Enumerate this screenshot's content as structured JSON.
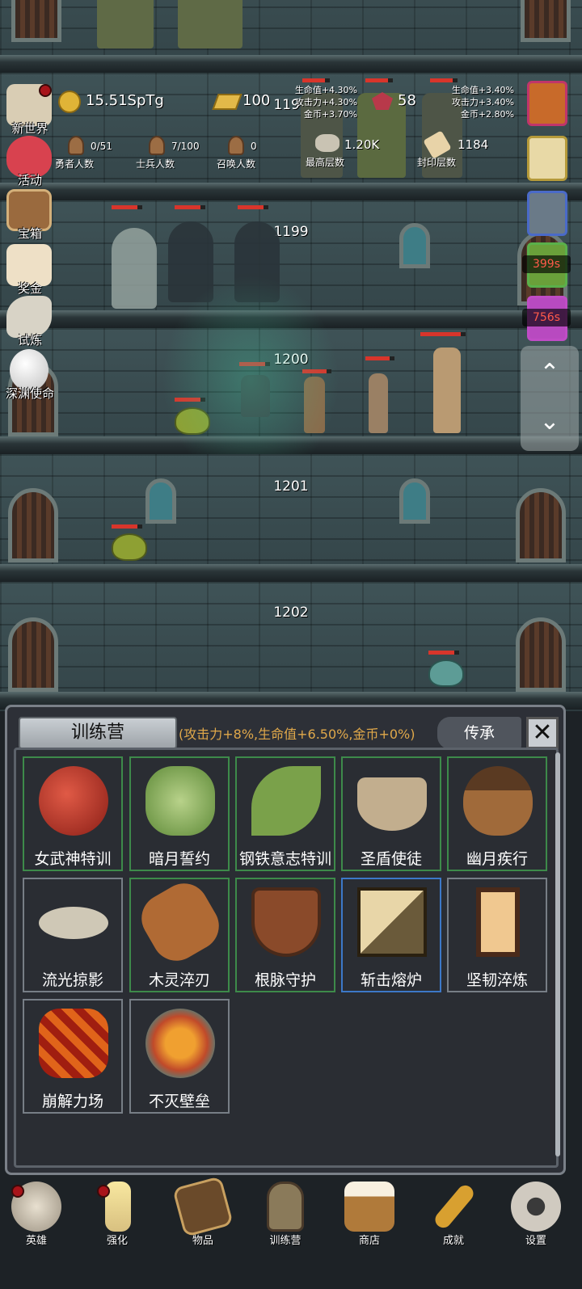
{
  "hud": {
    "gold": "15.51SpTg",
    "gold_bars": "100",
    "gems": "58",
    "heroes_count": "0/51",
    "heroes_label": "勇者人数",
    "soldiers_count": "7/100",
    "soldiers_label": "士兵人数",
    "summons_count": "0",
    "summons_label": "召唤人数",
    "max_floor_value": "1.20K",
    "max_floor_label": "最高层数",
    "sealed_floor_value": "1184",
    "sealed_floor_label": "封印层数",
    "bonus_left": [
      "生命值+4.30%",
      "攻击力+4.30%",
      "金币+3.70%"
    ],
    "bonus_right": [
      "生命值+3.40%",
      "攻击力+3.40%",
      "金币+2.80%"
    ]
  },
  "floors": [
    {
      "number": "1198"
    },
    {
      "number": "1199"
    },
    {
      "number": "1200"
    },
    {
      "number": "1201"
    },
    {
      "number": "1202"
    }
  ],
  "side_menu": [
    {
      "label": "新世界"
    },
    {
      "label": "活动"
    },
    {
      "label": "宝箱"
    },
    {
      "label": "奖金"
    },
    {
      "label": "试炼"
    },
    {
      "label": "深渊使命"
    }
  ],
  "right_menu": {
    "timer1": "399s",
    "timer2": "756s",
    "up_arrow": "⌃",
    "down_arrow": "⌄"
  },
  "panel": {
    "title": "训练营",
    "bonus": "(攻击力+8%,生命值+6.50%,金币+0%)",
    "inherit": "传承",
    "close": "✕",
    "items": [
      {
        "label": "女武神特训",
        "icon": "apple-icon"
      },
      {
        "label": "暗月誓约",
        "icon": "cabbage-icon"
      },
      {
        "label": "钢铁意志特训",
        "icon": "leaf-icon"
      },
      {
        "label": "圣盾使徒",
        "icon": "bowl-icon"
      },
      {
        "label": "幽月疾行",
        "icon": "acorn-icon"
      },
      {
        "label": "流光掠影",
        "icon": "fish-bone-icon"
      },
      {
        "label": "木灵淬刃",
        "icon": "log-icon"
      },
      {
        "label": "根脉守护",
        "icon": "wooden-shield-icon"
      },
      {
        "label": "斩击熔炉",
        "icon": "crate-icon"
      },
      {
        "label": "坚韧淬炼",
        "icon": "tower-shield-icon"
      },
      {
        "label": "崩解力场",
        "icon": "lava-orb-icon"
      },
      {
        "label": "不灭壁垒",
        "icon": "sun-shield-icon"
      }
    ]
  },
  "nav": [
    {
      "label": "英雄",
      "icon": "skull-icon"
    },
    {
      "label": "强化",
      "icon": "candle-icon"
    },
    {
      "label": "物品",
      "icon": "book-icon"
    },
    {
      "label": "训练营",
      "icon": "lantern-icon"
    },
    {
      "label": "商店",
      "icon": "mug-icon"
    },
    {
      "label": "成就",
      "icon": "key-icon"
    },
    {
      "label": "设置",
      "icon": "gear-icon"
    }
  ]
}
